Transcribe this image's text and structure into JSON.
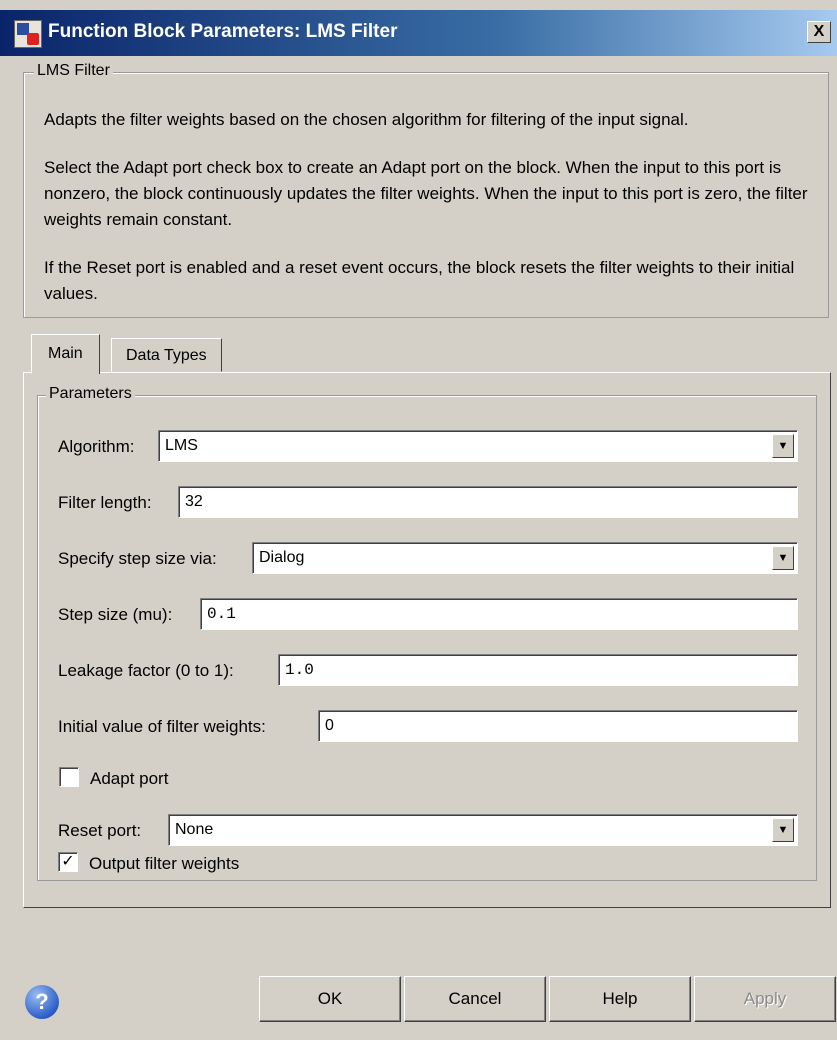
{
  "window": {
    "title": "Function Block Parameters: LMS Filter",
    "close_label": "X"
  },
  "description": {
    "group_title": "LMS Filter",
    "paragraphs": [
      "Adapts the filter weights based on the chosen algorithm for filtering of the input signal.",
      "Select the Adapt port check box to create an Adapt port on the block. When the input to this port is nonzero, the block continuously updates the filter weights. When the input to this port is zero, the filter weights remain constant.",
      "If the Reset port is enabled and a reset event occurs, the block resets the filter weights to their initial values."
    ]
  },
  "tabs": [
    {
      "label": "Main",
      "active": true
    },
    {
      "label": "Data Types",
      "active": false
    }
  ],
  "parameters": {
    "group_title": "Parameters",
    "algorithm": {
      "label": "Algorithm:",
      "value": "LMS"
    },
    "filter_length": {
      "label": "Filter length:",
      "value": "32"
    },
    "step_size_via": {
      "label": "Specify step size via:",
      "value": "Dialog"
    },
    "step_size": {
      "label": "Step size (mu):",
      "value": "0.1"
    },
    "leakage_factor": {
      "label": "Leakage factor (0 to 1):",
      "value": "1.0"
    },
    "initial_weights": {
      "label": "Initial value of filter weights:",
      "value": "0"
    },
    "adapt_port": {
      "label": "Adapt port",
      "checked": false,
      "mark": ""
    },
    "reset_port": {
      "label": "Reset port:",
      "value": "None"
    },
    "output_weights": {
      "label": "Output filter weights",
      "checked": true,
      "mark": "✓"
    }
  },
  "buttons": {
    "help_icon": "?",
    "ok": "OK",
    "cancel": "Cancel",
    "help": "Help",
    "apply": "Apply"
  },
  "icons": {
    "dropdown": "▼"
  }
}
